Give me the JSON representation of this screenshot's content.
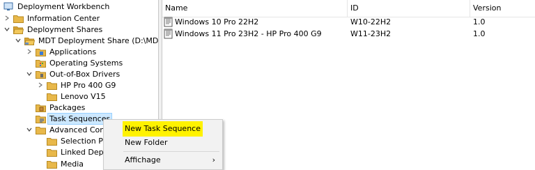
{
  "tree": {
    "root": "Deployment Workbench",
    "information_center": "Information Center",
    "deployment_shares": "Deployment Shares",
    "mdt_share": "MDT Deployment Share (D:\\MDT)",
    "applications": "Applications",
    "operating_systems": "Operating Systems",
    "oob_drivers": "Out-of-Box Drivers",
    "hp_pro": "HP Pro 400 G9",
    "lenovo": "Lenovo V15",
    "packages": "Packages",
    "task_sequences": "Task Sequences",
    "advanced_config": "Advanced Conf",
    "selection_profiles": "Selection Pr",
    "linked_deployment": "Linked Depl",
    "media": "Media"
  },
  "list": {
    "columns": [
      "Name",
      "ID",
      "Version"
    ],
    "rows": [
      {
        "name": "Windows 10 Pro 22H2",
        "id": "W10-22H2",
        "version": "1.0"
      },
      {
        "name": "Windows 11 Pro 23H2 - HP Pro 400 G9",
        "id": "W11-23H2",
        "version": "1.0"
      }
    ]
  },
  "context_menu": {
    "new_task_sequence": "New Task Sequence",
    "new_folder": "New Folder",
    "view": "Affichage",
    "view_arrow": "›"
  },
  "colors": {
    "folder": "#e8b84a",
    "highlight": "#fff200",
    "selection": "#cce8ff"
  }
}
